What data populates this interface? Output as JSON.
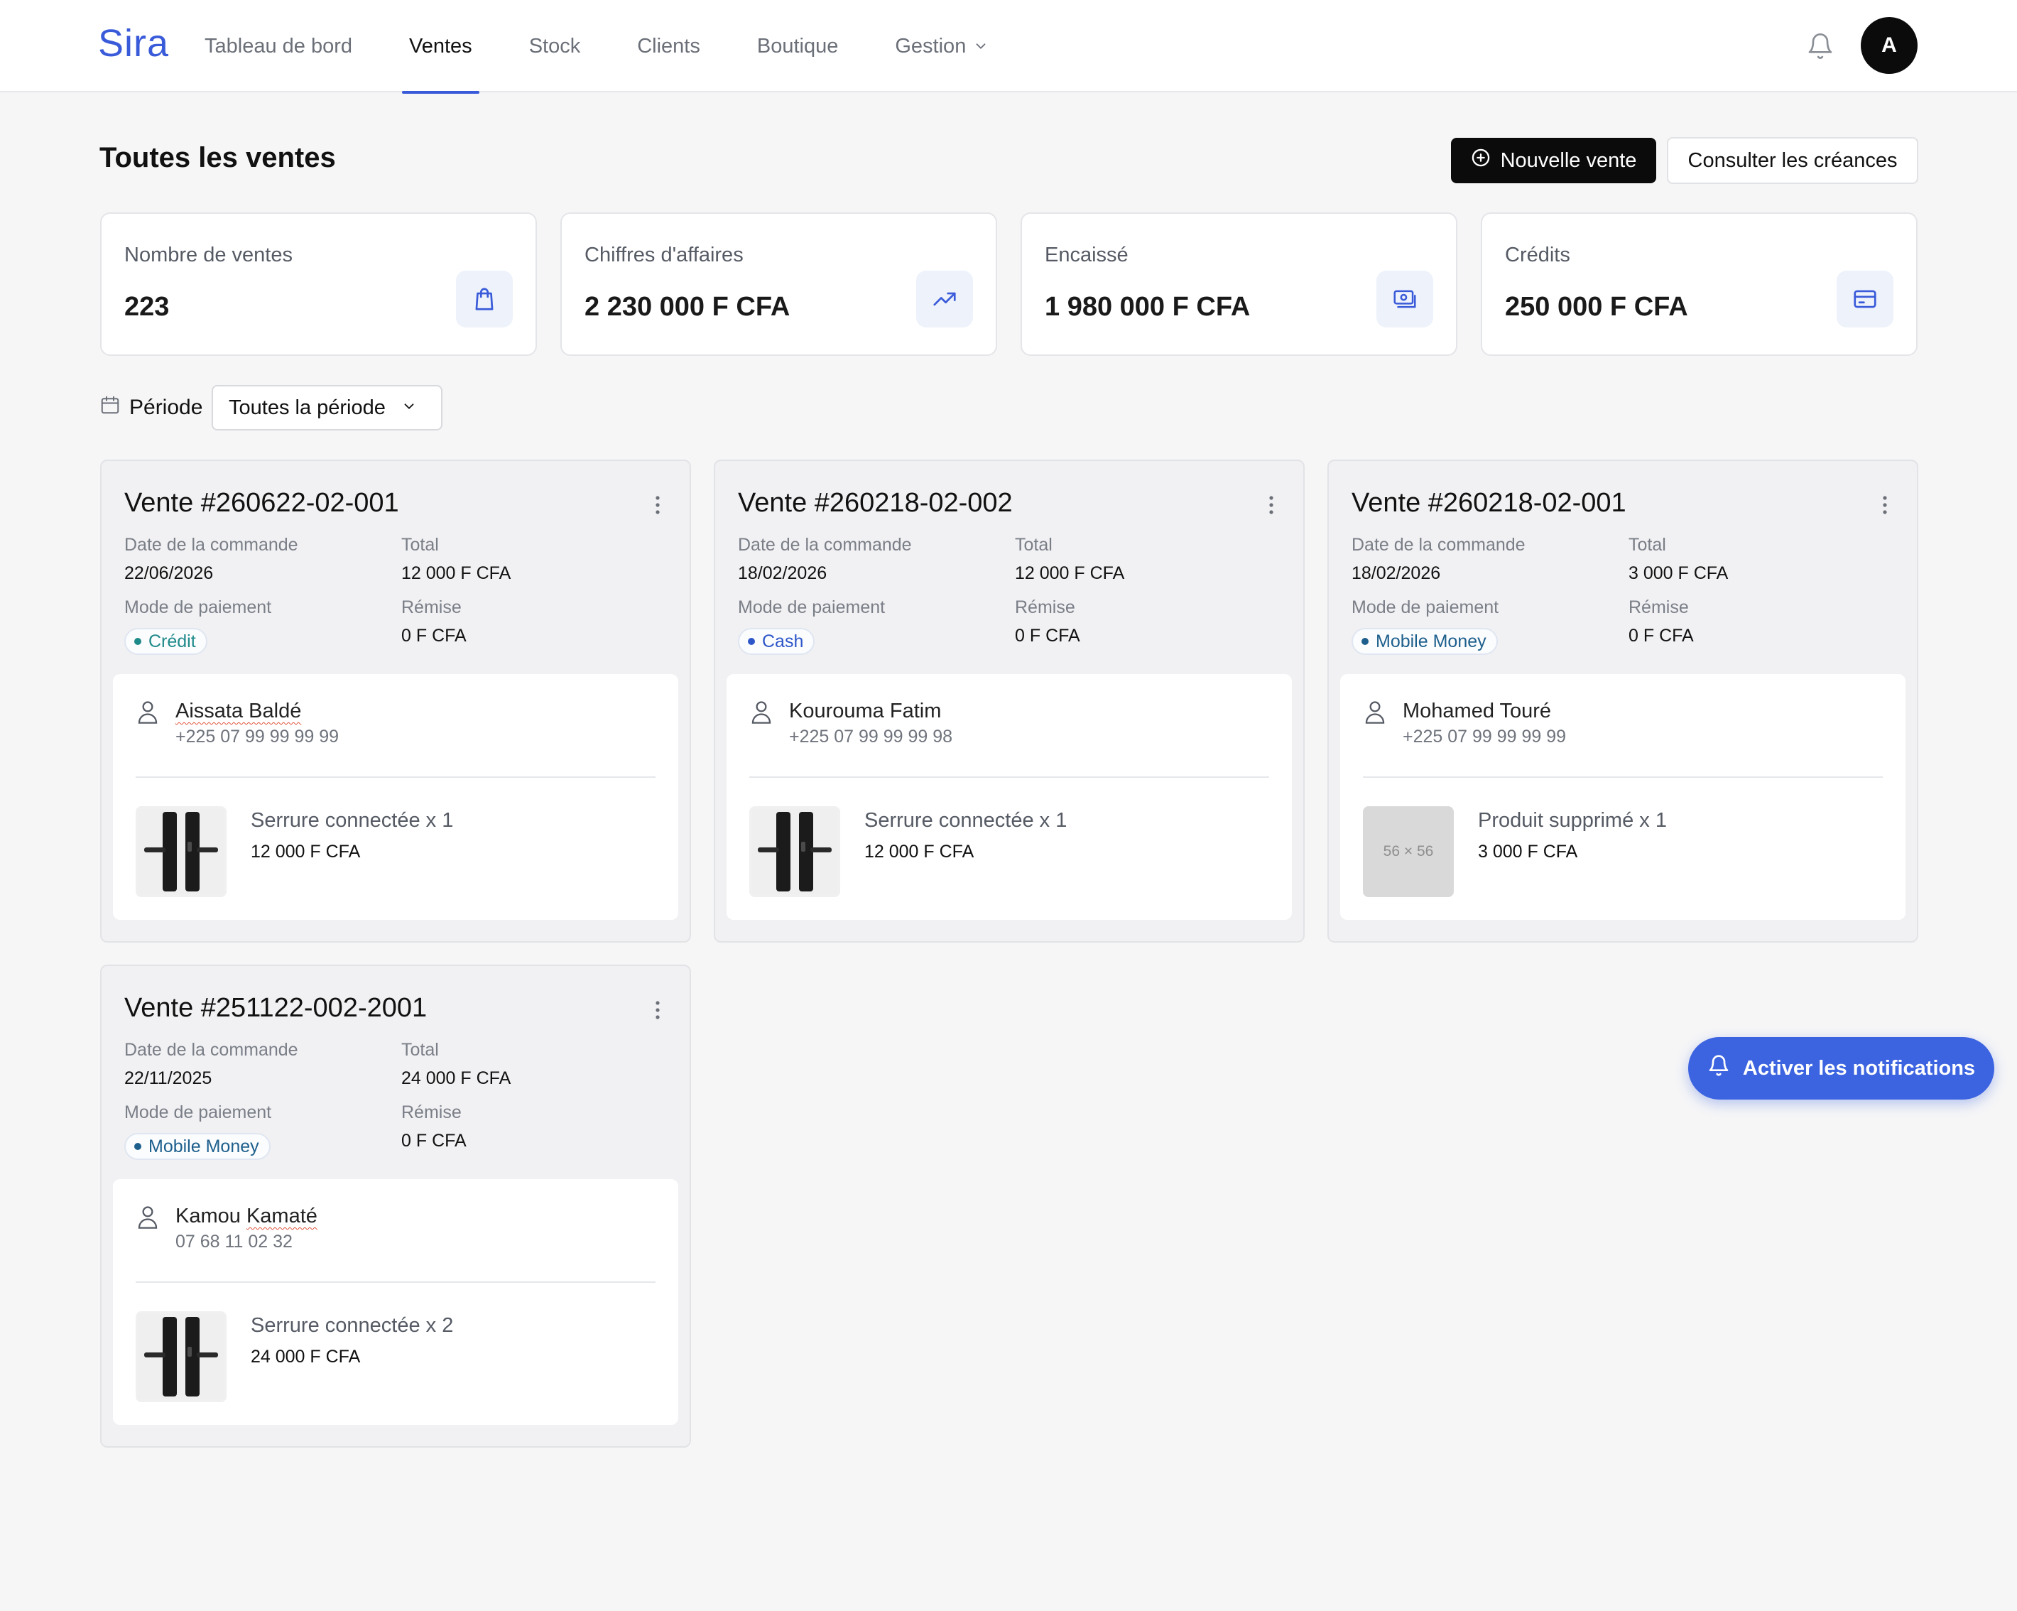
{
  "app": {
    "logo": "Sira"
  },
  "nav": {
    "items": [
      {
        "label": "Tableau de bord"
      },
      {
        "label": "Ventes",
        "active": true
      },
      {
        "label": "Stock"
      },
      {
        "label": "Clients"
      },
      {
        "label": "Boutique"
      },
      {
        "label": "Gestion",
        "has_dropdown": true
      }
    ],
    "avatar_initial": "A",
    "bell_icon": "bell-icon"
  },
  "header": {
    "title": "Toutes les ventes",
    "primary_button": "Nouvelle vente",
    "secondary_button": "Consulter les créances"
  },
  "stats": [
    {
      "label": "Nombre de ventes",
      "value": "223",
      "icon": "shopping-bag-icon"
    },
    {
      "label": "Chiffres d'affaires",
      "value": "2 230 000 F CFA",
      "icon": "trending-up-icon"
    },
    {
      "label": "Encaissé",
      "value": "1 980 000 F CFA",
      "icon": "banknote-icon"
    },
    {
      "label": "Crédits",
      "value": "250 000 F CFA",
      "icon": "credit-card-icon"
    }
  ],
  "filter": {
    "label": "Période",
    "selected": "Toutes la période",
    "icon": "calendar-icon"
  },
  "sale_labels": {
    "date": "Date de la commande",
    "total": "Total",
    "payment": "Mode de paiement",
    "discount": "Rémise"
  },
  "sales": [
    {
      "title": "Vente #260622-02-001",
      "date": "22/06/2026",
      "total": "12 000 F CFA",
      "payment": "Crédit",
      "payment_color": "#1f8a8a",
      "discount": "0 F CFA",
      "customer_name": "Aissata Baldé",
      "customer_phone": "+225 07 99 99 99 99",
      "product": "Serrure connectée x 1",
      "product_price": "12 000 F CFA",
      "product_image": "smart-lock"
    },
    {
      "title": "Vente #260218-02-002",
      "date": "18/02/2026",
      "total": "12 000 F CFA",
      "payment": "Cash",
      "payment_color": "#2d56c9",
      "discount": "0 F CFA",
      "customer_name": "Kourouma Fatim",
      "customer_phone": "+225 07 99 99 99 98",
      "product": "Serrure connectée x 1",
      "product_price": "12 000 F CFA",
      "product_image": "smart-lock"
    },
    {
      "title": "Vente #260218-02-001",
      "date": "18/02/2026",
      "total": "3 000 F CFA",
      "payment": "Mobile Money",
      "payment_color": "#1d5f8c",
      "discount": "0 F CFA",
      "customer_name": "Mohamed Touré",
      "customer_phone": "+225 07 99 99 99 99",
      "product": "Produit supprimé x 1",
      "product_price": "3 000 F CFA",
      "product_image": "placeholder",
      "placeholder_text": "56 × 56"
    },
    {
      "title": "Vente #251122-002-2001",
      "date": "22/11/2025",
      "total": "24 000 F CFA",
      "payment": "Mobile Money",
      "payment_color": "#1d5f8c",
      "discount": "0 F CFA",
      "customer_name": "Kamou Kamaté",
      "customer_phone": "07 68 11 02 32",
      "product": "Serrure connectée x 2",
      "product_price": "24 000 F CFA",
      "product_image": "smart-lock"
    }
  ],
  "notifications_button": "Activer les notifications",
  "colors": {
    "accent": "#3a5bd9",
    "primary_button": "#0b0b0b",
    "fab": "#3c63e0"
  }
}
